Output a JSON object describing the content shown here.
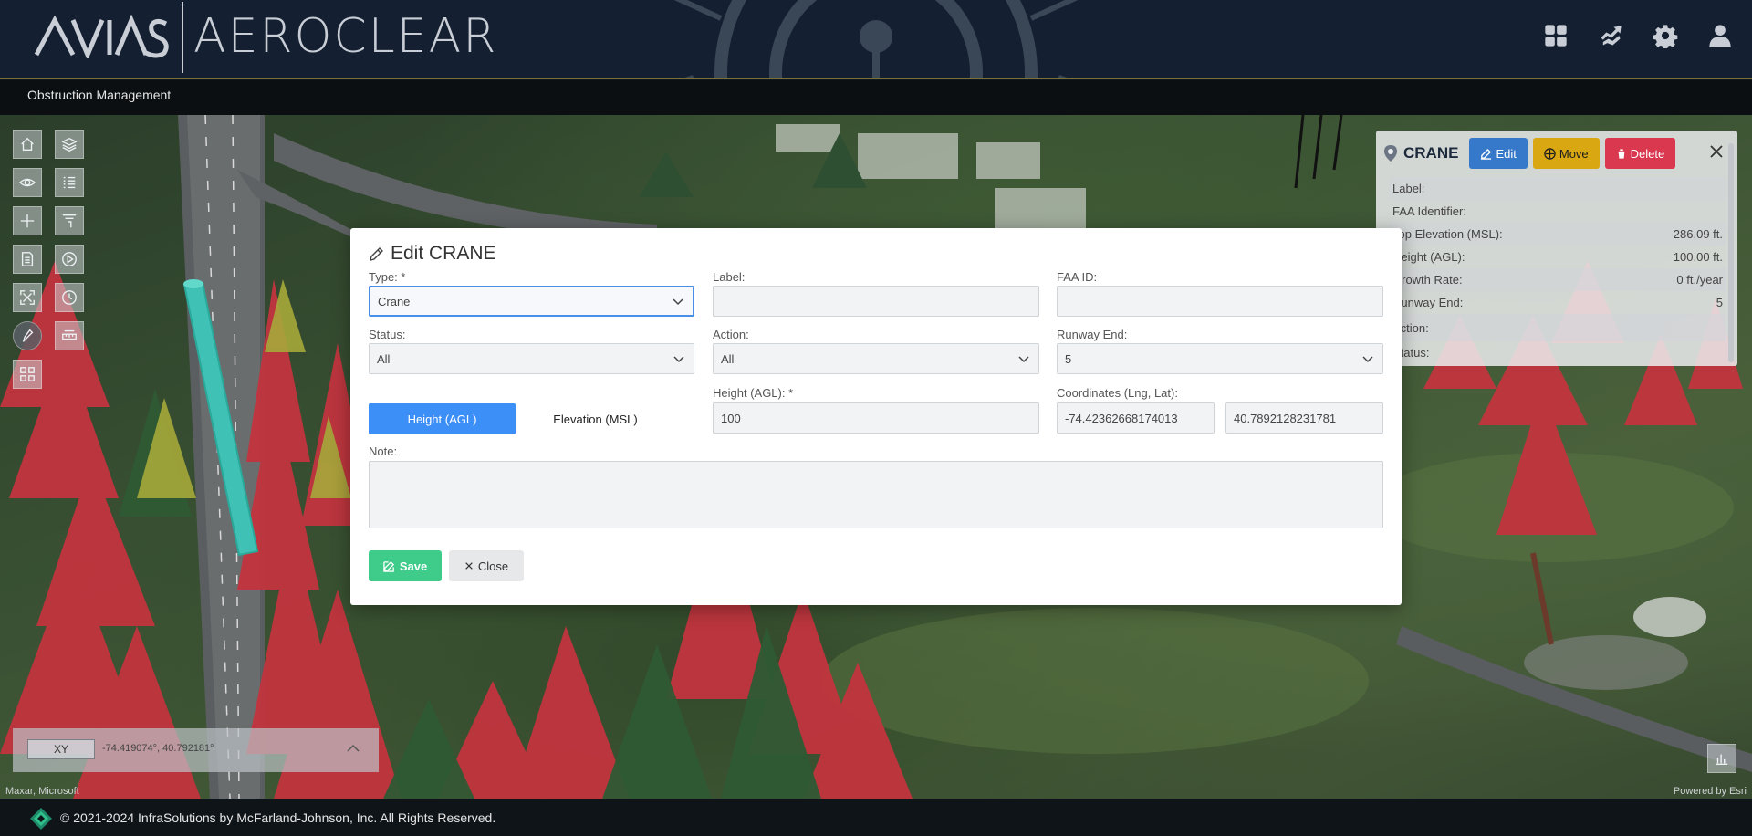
{
  "header": {
    "logo_mark": "AVIAS",
    "brand": "AEROCLEAR",
    "icons": [
      "apps-grid-icon",
      "share-icon",
      "gear-icon",
      "user-icon"
    ]
  },
  "subbar": {
    "title": "Obstruction Management"
  },
  "map": {
    "toolbar_icons": [
      "home-icon",
      "layers-icon",
      "eye-icon",
      "list-icon",
      "plus-icon",
      "filter-icon",
      "document-icon",
      "play-icon",
      "fullscreen-icon",
      "clock-icon",
      "pen-icon",
      "measure-icon",
      "qr-icon"
    ],
    "coord_mode": "XY",
    "coords": "-74.419074°, 40.792181°",
    "attribution_left": "Maxar, Microsoft",
    "attribution_right": "Powered by Esri"
  },
  "info_panel": {
    "title": "CRANE",
    "edit": "Edit",
    "move": "Move",
    "delete": "Delete",
    "rows": [
      {
        "label": "Label:",
        "value": ""
      },
      {
        "label": "FAA Identifier:",
        "value": ""
      },
      {
        "label": "Top Elevation (MSL):",
        "value": "286.09 ft."
      },
      {
        "label": "Height (AGL):",
        "value": "100.00 ft."
      },
      {
        "label": "Growth Rate:",
        "value": "0 ft./year"
      },
      {
        "label": "Runway End:",
        "value": "5"
      },
      {
        "label": "Action:",
        "value": ""
      },
      {
        "label": "Status:",
        "value": ""
      }
    ]
  },
  "modal": {
    "title": "Edit CRANE",
    "type_label": "Type: *",
    "type_value": "Crane",
    "label_label": "Label:",
    "label_value": "",
    "faa_label": "FAA ID:",
    "faa_value": "",
    "status_label": "Status:",
    "status_value": "All",
    "action_label": "Action:",
    "action_value": "All",
    "runway_label": "Runway End:",
    "runway_value": "5",
    "toggle_height": "Height (AGL)",
    "toggle_elevation": "Elevation (MSL)",
    "height_label": "Height (AGL): *",
    "height_value": "100",
    "coords_label": "Coordinates (Lng, Lat):",
    "lng_value": "-74.42362668174013",
    "lat_value": "40.7892128231781",
    "note_label": "Note:",
    "note_value": "",
    "save": "Save",
    "close": "Close"
  },
  "footer": {
    "text": "© 2021-2024 InfraSolutions by McFarland-Johnson, Inc. All Rights Reserved."
  },
  "colors": {
    "header_bg": "#142031",
    "accent_blue": "#3d8ff8",
    "save_green": "#3fcc8a",
    "move_yellow": "#d8a711",
    "delete_red": "#d9384f"
  }
}
